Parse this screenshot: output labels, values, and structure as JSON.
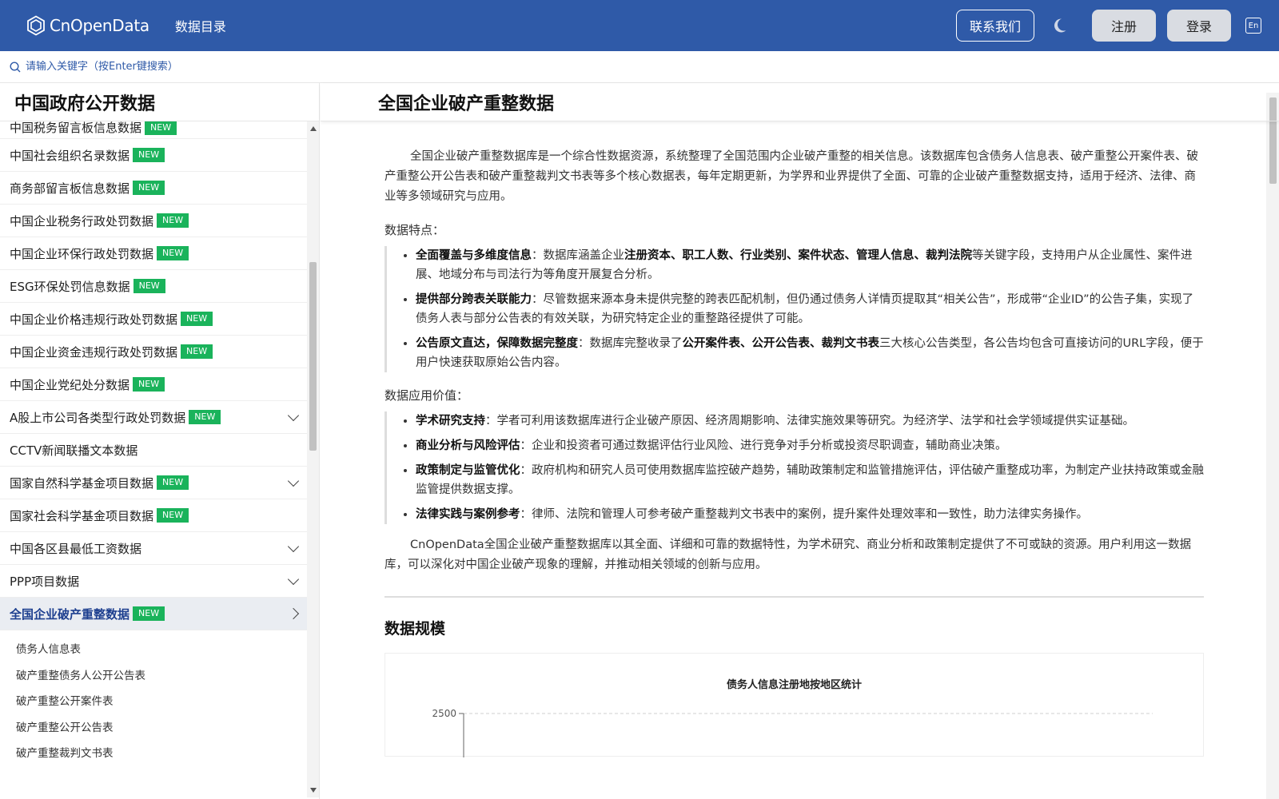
{
  "topbar": {
    "logo_text": "CnOpenData",
    "catalog_label": "数据目录",
    "contact_label": "联系我们",
    "register_label": "注册",
    "login_label": "登录",
    "lang_label": "En"
  },
  "search": {
    "placeholder": "请输入关键字（按Enter键搜索）"
  },
  "sidebar": {
    "title": "中国政府公开数据",
    "new_label": "NEW",
    "items": [
      {
        "label": "中国税务留言板信息数据",
        "new": true,
        "chevron": ""
      },
      {
        "label": "中国社会组织名录数据",
        "new": true,
        "chevron": ""
      },
      {
        "label": "商务部留言板信息数据",
        "new": true,
        "chevron": ""
      },
      {
        "label": "中国企业税务行政处罚数据",
        "new": true,
        "chevron": ""
      },
      {
        "label": "中国企业环保行政处罚数据",
        "new": true,
        "chevron": ""
      },
      {
        "label": "ESG环保处罚信息数据",
        "new": true,
        "chevron": ""
      },
      {
        "label": "中国企业价格违规行政处罚数据",
        "new": true,
        "chevron": ""
      },
      {
        "label": "中国企业资金违规行政处罚数据",
        "new": true,
        "chevron": ""
      },
      {
        "label": "中国企业党纪处分数据",
        "new": true,
        "chevron": ""
      },
      {
        "label": "A股上市公司各类型行政处罚数据",
        "new": true,
        "chevron": "down"
      },
      {
        "label": "CCTV新闻联播文本数据",
        "new": false,
        "chevron": ""
      },
      {
        "label": "国家自然科学基金项目数据",
        "new": true,
        "chevron": "down"
      },
      {
        "label": "国家社会科学基金项目数据",
        "new": true,
        "chevron": ""
      },
      {
        "label": "中国各区县最低工资数据",
        "new": false,
        "chevron": "down"
      },
      {
        "label": "PPP项目数据",
        "new": false,
        "chevron": "down"
      },
      {
        "label": "全国企业破产重整数据",
        "new": true,
        "chevron": "right",
        "active": true
      }
    ],
    "sub_items": [
      "债务人信息表",
      "破产重整债务人公开公告表",
      "破产重整公开案件表",
      "破产重整公开公告表",
      "破产重整裁判文书表"
    ]
  },
  "main": {
    "title": "全国企业破产重整数据",
    "intro": "全国企业破产重整数据库是一个综合性数据资源，系统整理了全国范围内企业破产重整的相关信息。该数据库包含债务人信息表、破产重整公开案件表、破产重整公开公告表和破产重整裁判文书表等多个核心数据表，每年定期更新，为学界和业界提供了全面、可靠的企业破产重整数据支持，适用于经济、法律、商业等多领域研究与应用。",
    "features_label": "数据特点：",
    "features": [
      {
        "pre": "",
        "bold": "全面覆盖与多维度信息",
        "sep": "：",
        "text1": "数据库涵盖企业",
        "bold2": "注册资本、职工人数、行业类别、案件状态、管理人信息、裁判法院",
        "text2": "等关键字段，支持用户从企业属性、案件进展、地域分布与司法行为等角度开展复合分析。"
      },
      {
        "pre": "",
        "bold": "提供部分跨表关联能力",
        "sep": "：",
        "text1": "尽管数据来源本身未提供完整的跨表匹配机制，但仍通过债务人详情页提取其“相关公告”，形成带“企业ID”的公告子集，实现了债务人表与部分公告表的有效关联，为研究特定企业的重整路径提供了可能。",
        "bold2": "",
        "text2": ""
      },
      {
        "pre": "",
        "bold": "公告原文直达，保障数据完整度",
        "sep": "：",
        "text1": "数据库完整收录了",
        "bold2": "公开案件表、公开公告表、裁判文书表",
        "text2": "三大核心公告类型，各公告均包含可直接访问的URL字段，便于用户快速获取原始公告内容。"
      }
    ],
    "value_label": "数据应用价值：",
    "values": [
      {
        "bold": "学术研究支持",
        "sep": "：",
        "text": "学者可利用该数据库进行企业破产原因、经济周期影响、法律实施效果等研究。为经济学、法学和社会学领域提供实证基础。"
      },
      {
        "bold": "商业分析与风险评估",
        "sep": "：",
        "text": "企业和投资者可通过数据评估行业风险、进行竞争对手分析或投资尽职调查，辅助商业决策。"
      },
      {
        "bold": "政策制定与监管优化",
        "sep": "：",
        "text": "政府机构和研究人员可使用数据库监控破产趋势，辅助政策制定和监管措施评估，评估破产重整成功率，为制定产业扶持政策或金融监管提供数据支撑。"
      },
      {
        "bold": "法律实践与案例参考",
        "sep": "：",
        "text": "律师、法院和管理人可参考破产重整裁判文书表中的案例，提升案件处理效率和一致性，助力法律实务操作。"
      }
    ],
    "closing": "CnOpenData全国企业破产重整数据库以其全面、详细和可靠的数据特性，为学术研究、商业分析和政策制定提供了不可或缺的资源。用户利用这一数据库，可以深化对中国企业破产现象的理解，并推动相关领域的创新与应用。",
    "scale_title": "数据规模"
  },
  "chart_data": {
    "type": "bar",
    "title": "债务人信息注册地按地区统计",
    "yticks": [
      2500
    ],
    "ylim": [
      0,
      2500
    ],
    "categories": [],
    "values": []
  },
  "colors": {
    "brand": "#2f5aa8",
    "new_badge": "#1ab35b",
    "active_bg": "#eaedf2",
    "active_text": "#1d3f8f"
  }
}
